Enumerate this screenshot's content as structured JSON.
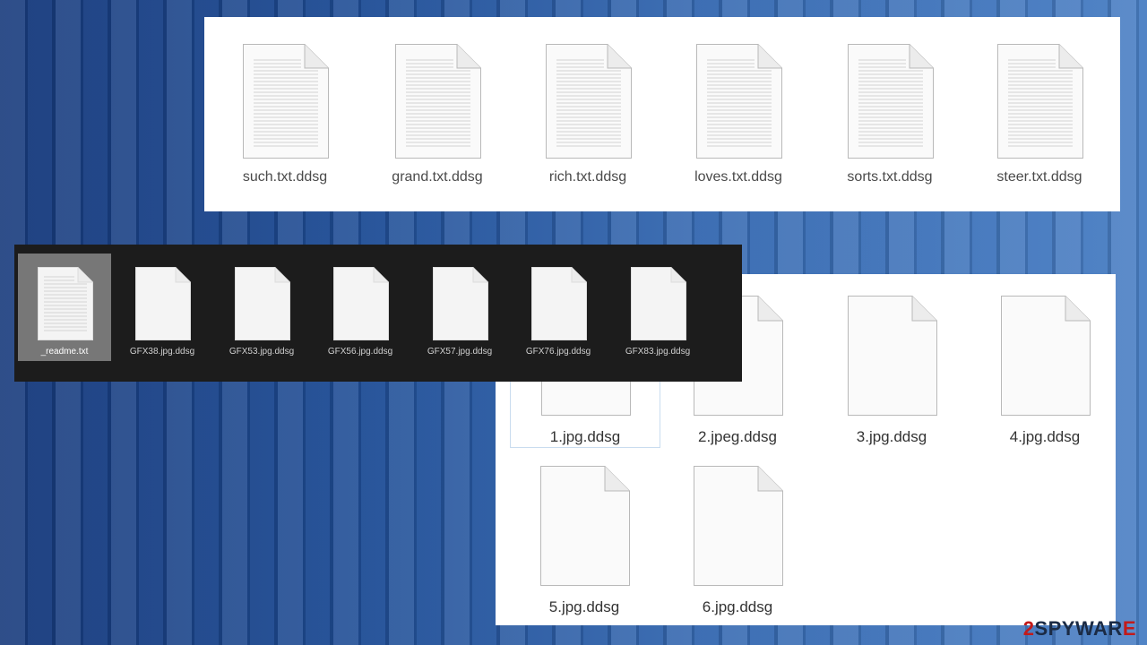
{
  "txt_files": [
    {
      "name": "such.txt.ddsg"
    },
    {
      "name": "grand.txt.ddsg"
    },
    {
      "name": "rich.txt.ddsg"
    },
    {
      "name": "loves.txt.ddsg"
    },
    {
      "name": "sorts.txt.ddsg"
    },
    {
      "name": "steer.txt.ddsg"
    }
  ],
  "dark_files": [
    {
      "name": "_readme.txt",
      "selected": true,
      "lined": true
    },
    {
      "name": "GFX38.jpg.ddsg"
    },
    {
      "name": "GFX53.jpg.ddsg"
    },
    {
      "name": "GFX56.jpg.ddsg"
    },
    {
      "name": "GFX57.jpg.ddsg"
    },
    {
      "name": "GFX76.jpg.ddsg"
    },
    {
      "name": "GFX83.jpg.ddsg"
    }
  ],
  "jpg_files": [
    {
      "name": "1.jpg.ddsg"
    },
    {
      "name": "2.jpeg.ddsg"
    },
    {
      "name": "3.jpg.ddsg"
    },
    {
      "name": "4.jpg.ddsg"
    },
    {
      "name": "5.jpg.ddsg"
    },
    {
      "name": "6.jpg.ddsg"
    }
  ],
  "watermark": {
    "num": "2",
    "txt": "SPYWAR",
    "suffix": "E"
  },
  "colors": {
    "background": "#1f4d95",
    "dark_panel": "#1c1c1c",
    "selection": "#777777"
  },
  "icons": {
    "file": "blank-document-icon",
    "text_file": "text-document-icon"
  }
}
